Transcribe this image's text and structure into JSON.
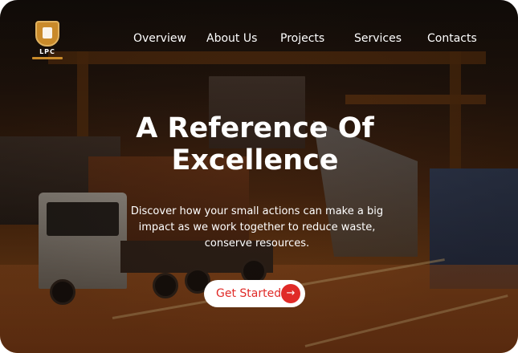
{
  "brand": {
    "logo_text": "LPC"
  },
  "nav": {
    "items": [
      {
        "label": "Overview"
      },
      {
        "label": "About Us"
      },
      {
        "label": "Projects"
      },
      {
        "label": "Services"
      },
      {
        "label": "Contacts"
      }
    ]
  },
  "hero": {
    "title_line1": "A Reference Of",
    "title_line2": "Excellence",
    "description": "Discover how your small actions can make a big impact as we work together to reduce waste, conserve resources.",
    "cta_label": "Get Started",
    "cta_icon": "arrow-right-icon"
  },
  "colors": {
    "accent": "#e02a27",
    "text": "#ffffff",
    "button_bg": "#ffffff"
  }
}
